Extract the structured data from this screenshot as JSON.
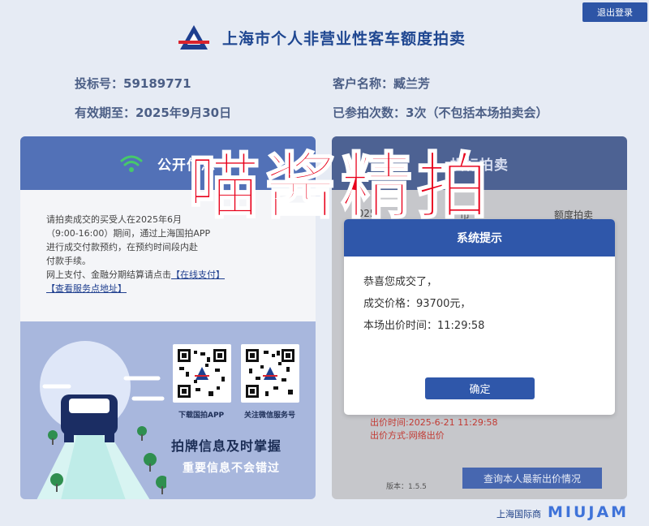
{
  "header": {
    "logout_label": "退出登录",
    "site_title": "上海市个人非营业性客车额度拍卖"
  },
  "user_info": {
    "bid_no_label": "投标号：",
    "bid_no": "59189771",
    "customer_label": "客户名称：",
    "customer_name": "臧兰芳",
    "valid_label": "有效期至：",
    "valid_until": "2025年9月30日",
    "attended_label": "已参拍次数：",
    "attended_value": "3次（不包括本场拍卖会）"
  },
  "public_info": {
    "title": "公开信息",
    "notice_part1": "请拍卖成交的买受人在2025年6月",
    "notice_part2": "（9:00-16:00）期间，通过上海国拍APP",
    "notice_part3": "进行成交付款预约，在预约时间段内赴",
    "notice_part4": "付款手续。",
    "notice_part5": "网上支付、金融分期结算请点击",
    "online_pay_link": "【在线支付】",
    "service_link": "【查看服务点地址】",
    "qr_app_caption": "下载国拍APP",
    "qr_wechat_caption": "关注微信服务号",
    "slogan_main": "拍牌信息及时掌握",
    "slogan_sub": "重要信息不会错过"
  },
  "bidding": {
    "title": "投标拍卖",
    "line1_left": "2025",
    "line1_mid": "市",
    "line1_right": "额度拍卖",
    "bid_time": "出价时间:2025-6-21 11:29:58",
    "bid_method": "出价方式:网络出价",
    "query_button": "查询本人最新出价情况",
    "version": "版本：1.5.5"
  },
  "dialog": {
    "title": "系统提示",
    "line1": "恭喜您成交了，",
    "line2": "成交价格：93700元，",
    "line3": "本场出价时间：11:29:58",
    "ok_button": "确定"
  },
  "footer": {
    "text": "上海国际商"
  },
  "watermark": {
    "big": "喵酱精拍",
    "small": "MIUJAM"
  },
  "colors": {
    "brand_blue": "#2f57aa",
    "watermark_red": "#e8001b"
  }
}
